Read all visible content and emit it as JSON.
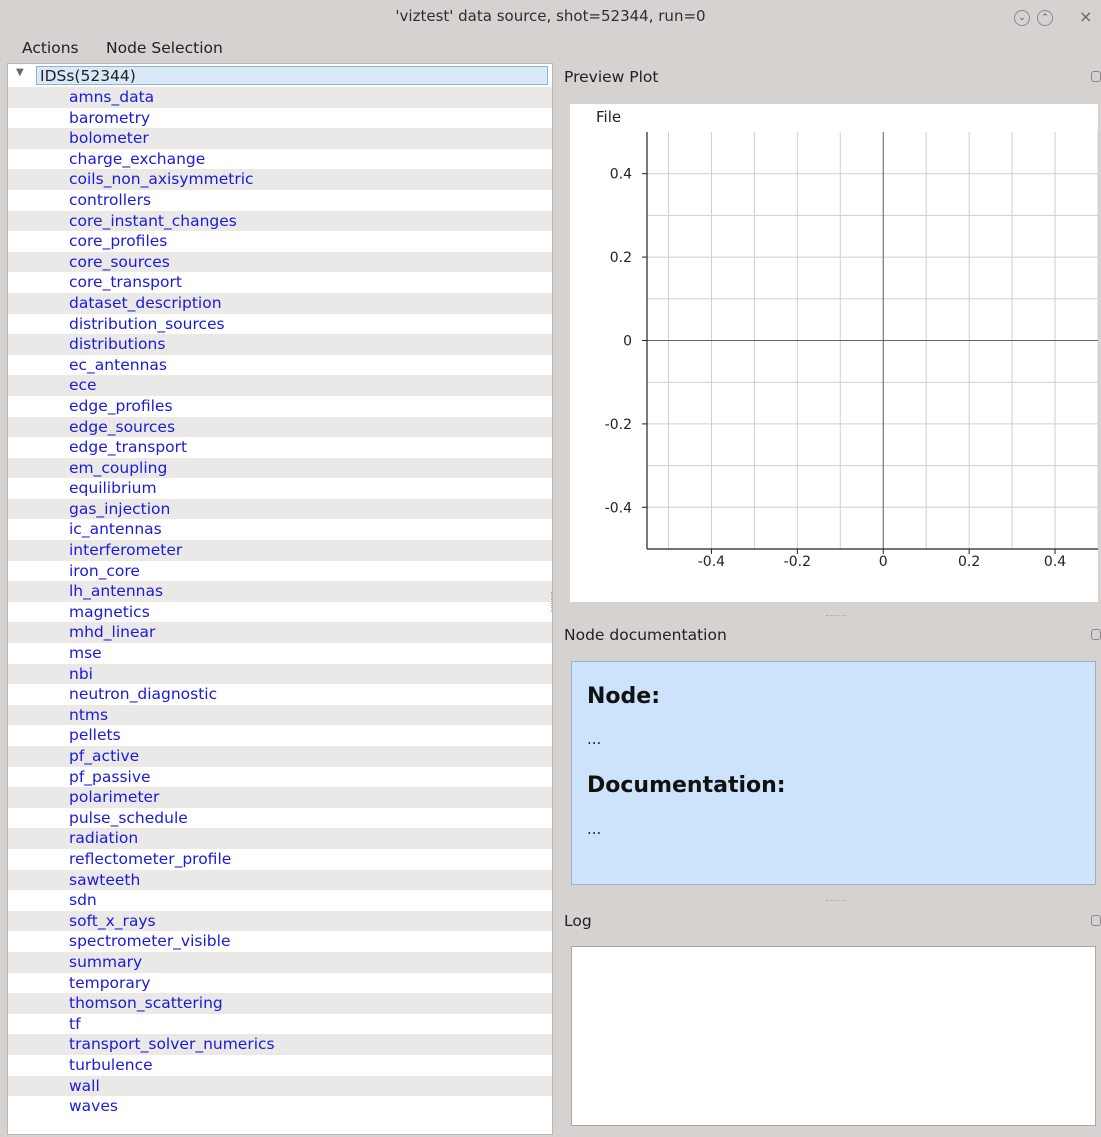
{
  "window": {
    "title": "'viztest' data source, shot=52344, run=0",
    "controls": {
      "minimize": "chevron-down",
      "maximize": "chevron-up",
      "close": "×"
    }
  },
  "menubar": {
    "items": [
      "Actions",
      "Node Selection"
    ]
  },
  "tree": {
    "root_label": "IDSs(52344)",
    "toggle_glyph": "▼",
    "items": [
      "amns_data",
      "barometry",
      "bolometer",
      "charge_exchange",
      "coils_non_axisymmetric",
      "controllers",
      "core_instant_changes",
      "core_profiles",
      "core_sources",
      "core_transport",
      "dataset_description",
      "distribution_sources",
      "distributions",
      "ec_antennas",
      "ece",
      "edge_profiles",
      "edge_sources",
      "edge_transport",
      "em_coupling",
      "equilibrium",
      "gas_injection",
      "ic_antennas",
      "interferometer",
      "iron_core",
      "lh_antennas",
      "magnetics",
      "mhd_linear",
      "mse",
      "nbi",
      "neutron_diagnostic",
      "ntms",
      "pellets",
      "pf_active",
      "pf_passive",
      "polarimeter",
      "pulse_schedule",
      "radiation",
      "reflectometer_profile",
      "sawteeth",
      "sdn",
      "soft_x_rays",
      "spectrometer_visible",
      "summary",
      "temporary",
      "thomson_scattering",
      "tf",
      "transport_solver_numerics",
      "turbulence",
      "wall",
      "waves"
    ]
  },
  "preview_plot": {
    "title": "Preview Plot",
    "file_menu": "File"
  },
  "chart_data": {
    "type": "line",
    "series": [],
    "xlim": [
      -0.55,
      0.5
    ],
    "ylim": [
      -0.5,
      0.5
    ],
    "x_ticks": [
      -0.4,
      -0.2,
      0,
      0.2,
      0.4
    ],
    "y_ticks": [
      0.4,
      0.2,
      0,
      -0.2,
      -0.4
    ],
    "x_tick_labels": [
      "-0.4",
      "-0.2",
      "0",
      "0.2",
      "0.4"
    ],
    "y_tick_labels": [
      "0.4",
      "0.2",
      "0",
      "-0.2",
      "-0.4"
    ],
    "grid": true,
    "title": "",
    "xlabel": "",
    "ylabel": ""
  },
  "node_documentation": {
    "title": "Node documentation",
    "node_heading": "Node:",
    "node_value": "...",
    "doc_heading": "Documentation:",
    "doc_value": "..."
  },
  "log": {
    "title": "Log"
  }
}
